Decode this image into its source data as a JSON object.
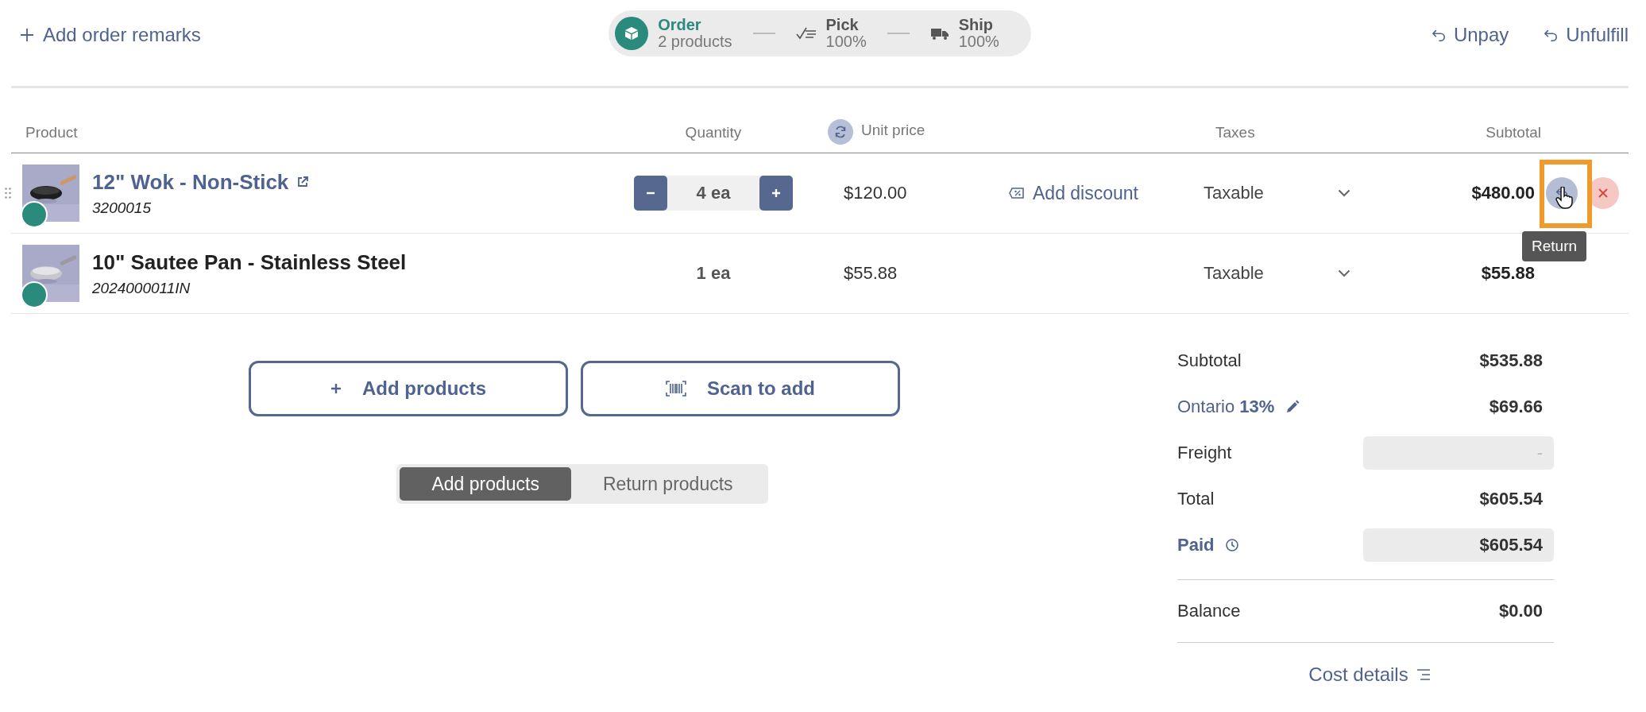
{
  "toolbar": {
    "add_remarks": "Add order remarks",
    "actions": [
      {
        "label": "Unpay"
      },
      {
        "label": "Unfulfill"
      }
    ]
  },
  "progress": [
    {
      "kind": "order",
      "title": "Order",
      "detail": "2 products",
      "selected": true
    },
    {
      "kind": "pick",
      "title": "Pick",
      "detail": "100%",
      "selected": false
    },
    {
      "kind": "ship",
      "title": "Ship",
      "detail": "100%",
      "selected": false
    }
  ],
  "table": {
    "columns": [
      "Product",
      "Quantity",
      "Unit price",
      "Taxes",
      "Subtotal"
    ],
    "rows": [
      {
        "name": "12\" Wok - Non-Stick",
        "sku": "3200015",
        "hovered": true,
        "quantity": "4 ea",
        "unit_price": "$120.00",
        "discount": "Add discount",
        "tax": "Taxable",
        "subtotal": "$480.00",
        "tooltip": "Return"
      },
      {
        "name": "10\" Sautee Pan - Stainless Steel",
        "sku": "2024000011IN",
        "hovered": false,
        "quantity": "1 ea",
        "unit_price": "$55.88",
        "tax": "Taxable",
        "subtotal": "$55.88"
      }
    ]
  },
  "buttons": [
    {
      "kind": "add",
      "label": "Add products"
    },
    {
      "kind": "scan",
      "label": "Scan to add"
    }
  ],
  "mode_tabs": [
    {
      "label": "Add products",
      "selected": true
    },
    {
      "label": "Return products",
      "selected": false
    }
  ],
  "totals": [
    {
      "kind": "plain",
      "label": "Subtotal",
      "value": "$535.88"
    },
    {
      "kind": "tax",
      "label": "Ontario **13%**",
      "value": "$69.66"
    },
    {
      "kind": "field",
      "label": "Freight",
      "placeholder": "-"
    },
    {
      "kind": "plain",
      "label": "Total",
      "value": "$605.54"
    },
    {
      "kind": "paid",
      "label": "Paid",
      "value": "$605.54"
    },
    {
      "kind": "balance",
      "label": "Balance",
      "value": "$0.00"
    }
  ],
  "cost_details": "Cost details"
}
